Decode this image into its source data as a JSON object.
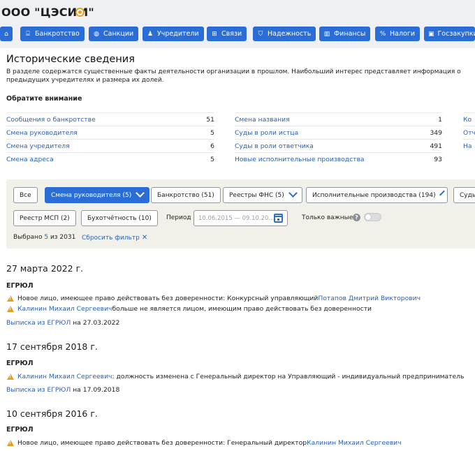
{
  "header": {
    "company_name": "ООО \"ЦЭСИМ\"",
    "nav": [
      {
        "label": "",
        "icon": "home-icon"
      },
      {
        "label": "Банкротство",
        "icon": "bank-icon"
      },
      {
        "label": "Санкции",
        "icon": "globe-icon"
      },
      {
        "label": "Учредители",
        "icon": "people-icon"
      },
      {
        "label": "Связи",
        "icon": "links-icon"
      },
      {
        "label": "Надежность",
        "icon": "shield-icon"
      },
      {
        "label": "Финансы",
        "icon": "chart-icon"
      },
      {
        "label": "Налоги",
        "icon": "percent-icon"
      },
      {
        "label": "Госзакупки",
        "icon": "briefcase-icon"
      }
    ]
  },
  "page": {
    "title": "Исторические сведения",
    "intro": "В разделе содержатся существенные факты деятельности организации в прошлом. Наибольший интерес представляет информация о предыдущих учредителях и размера их долей.",
    "attention_heading": "Обратите внимание"
  },
  "stats": {
    "col1": [
      {
        "label": "Сообщения о банкротстве",
        "value": "51"
      },
      {
        "label": "Смена руководителя",
        "value": "5"
      },
      {
        "label": "Смена учредителя",
        "value": "6"
      },
      {
        "label": "Смена адреса",
        "value": "5"
      }
    ],
    "col2": [
      {
        "label": "Смена названия",
        "value": "1"
      },
      {
        "label": "Суды в роли истца",
        "value": "349"
      },
      {
        "label": "Суды в роли ответчика",
        "value": "491"
      },
      {
        "label": "Новые исполнительные производства",
        "value": "93"
      }
    ],
    "col3": [
      {
        "label": "Ко"
      },
      {
        "label": "Отч"
      },
      {
        "label": "На"
      }
    ]
  },
  "filters": {
    "buttons": [
      {
        "label": "Все",
        "active": false
      },
      {
        "label": "Смена руководителя (5)",
        "active": true
      },
      {
        "label": "Банкротство (51)",
        "active": false
      },
      {
        "label": "Реестры ФНС (5)",
        "active": false
      },
      {
        "label": "Исполнительные производства (194)",
        "active": false
      },
      {
        "label": "Суды",
        "active": false
      },
      {
        "label": "Реестр МСП (2)",
        "active": false
      },
      {
        "label": "Бухотчётность (10)",
        "active": false
      }
    ],
    "period_label": "Период",
    "period_placeholder": "10.06.2015 — 09.10.20...",
    "only_important_label": "Только важные",
    "only_important_on": false,
    "selected_prefix": "Выбрано",
    "selected_count": "5",
    "selected_suffix": "из 2031",
    "reset_label": "Сбросить фильтр"
  },
  "timeline": [
    {
      "date": "27 марта 2022 г.",
      "source": "ЕГРЮЛ",
      "events": [
        {
          "before": "",
          "text": "Новое лицо, имеющее право действовать без доверенности: Конкурсный управляющий ",
          "person": "Потапов Дмитрий Викторович",
          "after": ""
        },
        {
          "before": "Калинин Михаил Сергеевич",
          "text": " больше не является лицом, имеющим право действовать без доверенности",
          "person": "",
          "after": ""
        }
      ],
      "extract_link": "Выписка из ЕГРЮЛ",
      "extract_suffix": "на 27.03.2022"
    },
    {
      "date": "17 сентября 2018 г.",
      "source": "ЕГРЮЛ",
      "events": [
        {
          "before": "Калинин Михаил Сергеевич",
          "text": ": должность изменена с Генеральный директор на Управляющий - индивидуальный предприниматель",
          "person": "",
          "after": ""
        }
      ],
      "extract_link": "Выписка из ЕГРЮЛ",
      "extract_suffix": "на 17.09.2018"
    },
    {
      "date": "10 сентября 2016 г.",
      "source": "ЕГРЮЛ",
      "events": [
        {
          "before": "",
          "text": "Новое лицо, имеющее право действовать без доверенности: Генеральный директор ",
          "person": "Калинин Михаил Сергеевич",
          "after": ""
        }
      ]
    }
  ]
}
